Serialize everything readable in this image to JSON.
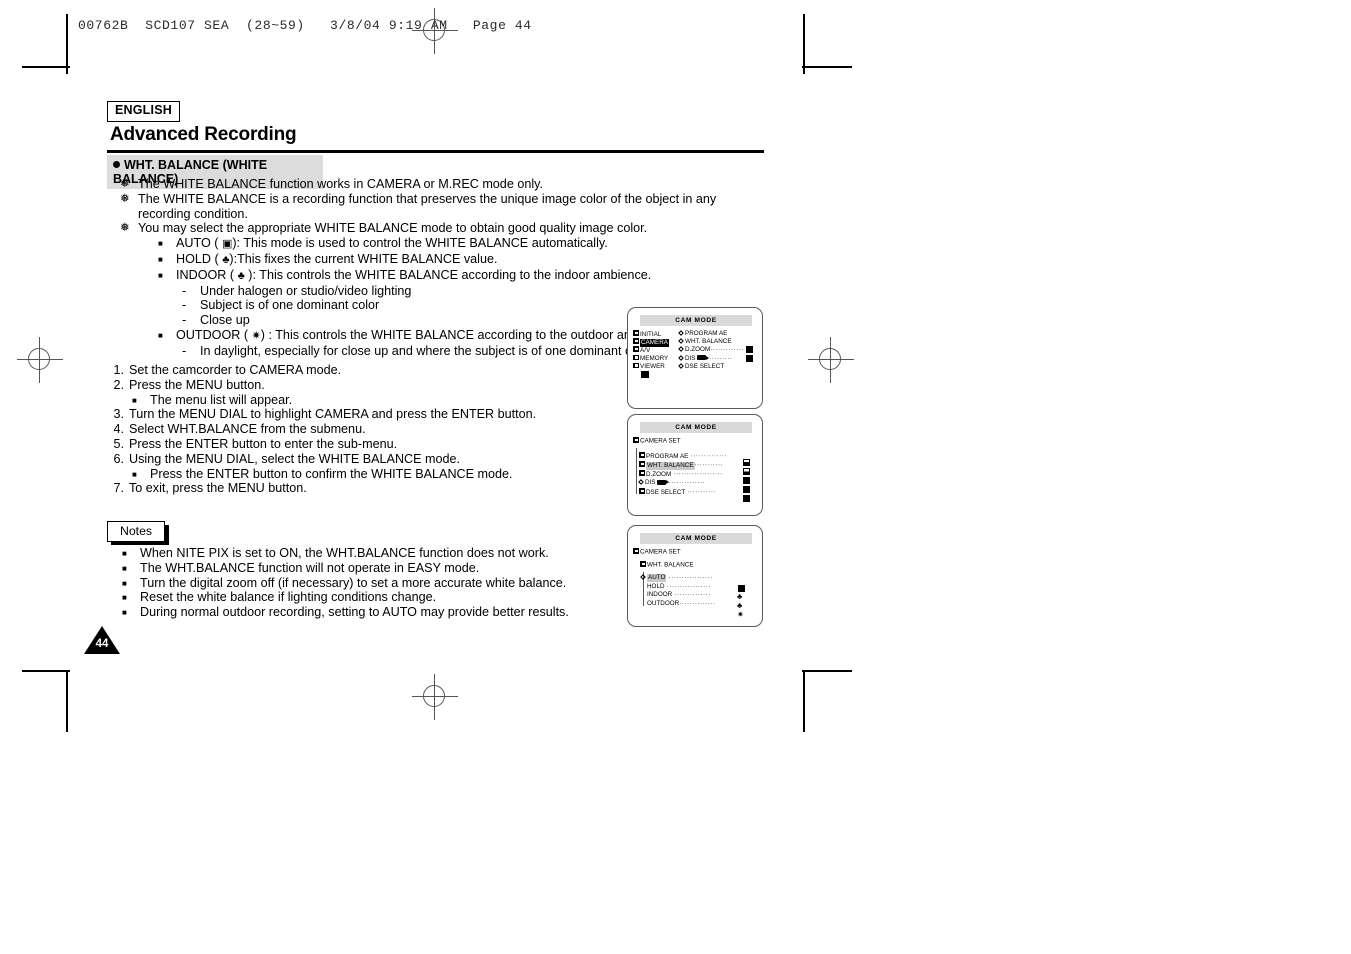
{
  "prepress": {
    "running_head": "00762B  SCD107 SEA  (28~59)   3/8/04 9:19 AM   Page 44"
  },
  "header": {
    "language_badge": "ENGLISH",
    "chapter_title": "Advanced Recording",
    "section_title": "WHT. BALANCE (WHITE BALANCE)"
  },
  "intro_bullets": [
    {
      "marker": "❅",
      "text": "The WHITE BALANCE function works in CAMERA or M.REC mode only."
    },
    {
      "marker": "❅",
      "text": "The WHITE BALANCE is a recording function that preserves the unique image color of the object in any recording condition."
    },
    {
      "marker": "❅",
      "text": "You may select the appropriate WHITE BALANCE mode to obtain good quality image color."
    }
  ],
  "modes": [
    {
      "marker": "■",
      "name": "AUTO",
      "icon": "auto-square-icon",
      "icon_glyph": "⛃",
      "text": "): This mode is used to control the WHITE BALANCE automatically.",
      "prefix": "AUTO ( "
    },
    {
      "marker": "■",
      "name": "HOLD",
      "icon": "hold-clover-icon",
      "icon_glyph": "♣",
      "text": "):This fixes the current WHITE BALANCE value.",
      "prefix": "HOLD ( "
    },
    {
      "marker": "■",
      "name": "INDOOR",
      "icon": "indoor-bulb-icon",
      "icon_glyph": "♣",
      "text": " ): This controls the WHITE BALANCE according to the indoor ambience.",
      "prefix": "INDOOR ( "
    }
  ],
  "indoor_subitems": [
    {
      "marker": "-",
      "text": "Under halogen or studio/video lighting"
    },
    {
      "marker": "-",
      "text": "Subject is of one dominant color"
    },
    {
      "marker": "-",
      "text": "Close up"
    }
  ],
  "outdoor": {
    "marker": "■",
    "prefix": "OUTDOOR ( ",
    "icon": "outdoor-sun-icon",
    "icon_glyph": "✹",
    "text": ") : This controls the WHITE BALANCE according to the outdoor ambience.",
    "subitems": [
      {
        "marker": "-",
        "text": "In daylight, especially for close up and where the subject is of one dominant color."
      }
    ]
  },
  "steps": [
    {
      "num": "1.",
      "text": "Set the camcorder to CAMERA mode.",
      "sub": []
    },
    {
      "num": "2.",
      "text": "Press the MENU button.",
      "sub": [
        {
          "marker": "■",
          "text": "The menu list will appear."
        }
      ]
    },
    {
      "num": "3.",
      "text": "Turn the MENU DIAL to highlight CAMERA and press the ENTER button.",
      "sub": []
    },
    {
      "num": "4.",
      "text": "Select WHT.BALANCE from the submenu.",
      "sub": []
    },
    {
      "num": "5.",
      "text": "Press the ENTER button to enter the sub-menu.",
      "sub": []
    },
    {
      "num": "6.",
      "text": "Using the MENU DIAL, select the WHITE BALANCE mode.",
      "sub": [
        {
          "marker": "■",
          "text": "Press the ENTER button to confirm the WHITE BALANCE mode."
        }
      ]
    },
    {
      "num": "7.",
      "text": "To exit, press the MENU button.",
      "sub": []
    }
  ],
  "notes": {
    "tab_label": "Notes",
    "items": [
      {
        "marker": "■",
        "text": "When NITE PIX is set to ON, the WHT.BALANCE function does not work."
      },
      {
        "marker": "■",
        "text": "The WHT.BALANCE function will not operate in EASY mode."
      },
      {
        "marker": "■",
        "text": "Turn the digital zoom off (if necessary) to set a more accurate white balance."
      },
      {
        "marker": "■",
        "text": "Reset the white balance if lighting conditions change."
      },
      {
        "marker": "■",
        "text": "During normal outdoor recording, setting to AUTO may provide better results."
      }
    ]
  },
  "page_number": "44",
  "screens": [
    {
      "id": "screen-1",
      "title": "CAM MODE",
      "left_menu": [
        {
          "label": "INITIAL",
          "highlight": false
        },
        {
          "label": "CAMERA",
          "highlight": true
        },
        {
          "label": "A/V",
          "highlight": false
        },
        {
          "label": "MEMORY",
          "highlight": false
        },
        {
          "label": "VIEWER",
          "highlight": false
        }
      ],
      "right_menu": [
        {
          "label": "PROGRAM AE",
          "dots": false
        },
        {
          "label": "WHT. BALANCE",
          "dots": false
        },
        {
          "label": "D.ZOOM",
          "dots": true
        },
        {
          "label": "DIS",
          "dots": true,
          "cam_icon": true
        },
        {
          "label": "DSE SELECT",
          "dots": false
        }
      ]
    },
    {
      "id": "screen-2",
      "title": "CAM MODE",
      "breadcrumb": "CAMERA SET",
      "rows": [
        {
          "label": "PROGRAM AE",
          "dots": true,
          "highlight": false,
          "box": "half"
        },
        {
          "label": "WHT. BALANCE",
          "dots": true,
          "highlight": true,
          "box": "half"
        },
        {
          "label": "D.ZOOM",
          "dots": true,
          "highlight": false,
          "box": "solid"
        },
        {
          "label": "DIS",
          "dots": true,
          "highlight": false,
          "box": "solid",
          "cam_icon": true
        },
        {
          "label": "DSE SELECT",
          "dots": true,
          "highlight": false,
          "box": "solid"
        }
      ]
    },
    {
      "id": "screen-3",
      "title": "CAM MODE",
      "breadcrumb": "CAMERA SET",
      "breadcrumb2": "WHT. BALANCE",
      "rows": [
        {
          "label": "AUTO",
          "dots": true,
          "highlight": true,
          "icon": "auto-square-icon"
        },
        {
          "label": "HOLD",
          "dots": true,
          "highlight": false,
          "icon": "hold-clover-icon"
        },
        {
          "label": "INDOOR",
          "dots": true,
          "highlight": false,
          "icon": "indoor-bulb-icon"
        },
        {
          "label": "OUTDOOR",
          "dots": true,
          "highlight": false,
          "icon": "outdoor-sun-icon"
        }
      ]
    }
  ]
}
